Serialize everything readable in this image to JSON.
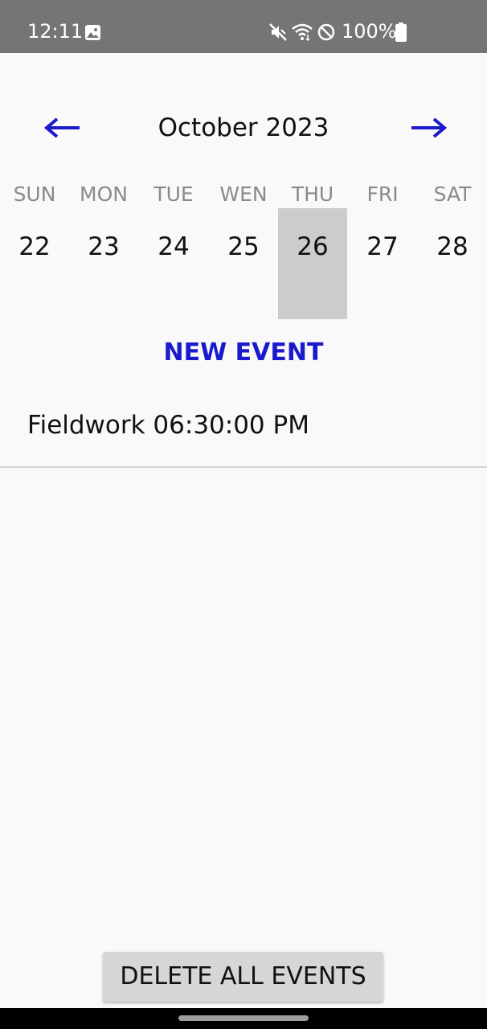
{
  "status_bar": {
    "time": "12:11",
    "battery": "100%",
    "icons": [
      "image-icon",
      "mute-icon",
      "wifi-icon",
      "block-icon",
      "battery-icon"
    ]
  },
  "calendar": {
    "month_title": "October 2023",
    "prev_icon": "arrow-left-icon",
    "next_icon": "arrow-right-icon",
    "days": [
      {
        "name": "SUN",
        "number": "22"
      },
      {
        "name": "MON",
        "number": "23"
      },
      {
        "name": "TUE",
        "number": "24"
      },
      {
        "name": "WEN",
        "number": "25"
      },
      {
        "name": "THU",
        "number": "26"
      },
      {
        "name": "FRI",
        "number": "27"
      },
      {
        "name": "SAT",
        "number": "28"
      }
    ],
    "selected_day": "26"
  },
  "actions": {
    "new_event": "NEW EVENT",
    "delete_all": "DELETE ALL EVENTS"
  },
  "events": [
    {
      "label": "Fieldwork 06:30:00 PM"
    }
  ],
  "colors": {
    "accent": "#1a1acc",
    "status_bar": "#757575",
    "selected_day": "#cccccc"
  }
}
